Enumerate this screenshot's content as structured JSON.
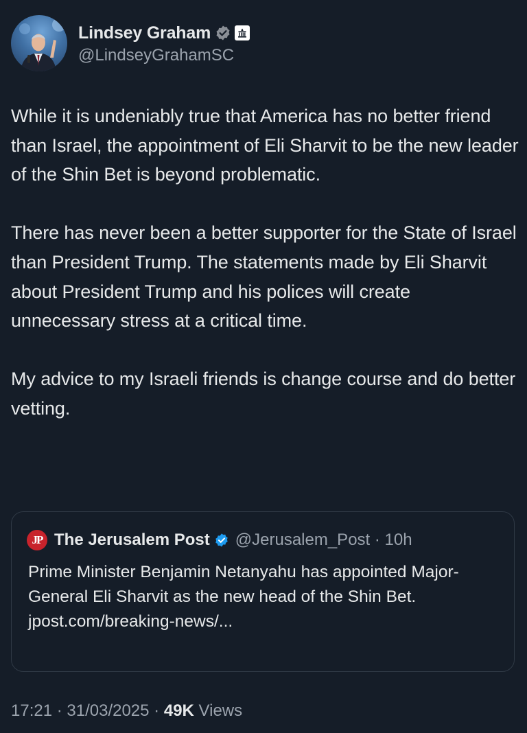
{
  "author": {
    "display_name": "Lindsey Graham",
    "handle": "@LindseyGrahamSC",
    "verified_icon": "verified-badge-icon",
    "affiliation_icon": "government-building-icon",
    "colors": {
      "verified": "#8a8f96"
    }
  },
  "tweet": {
    "paragraphs": [
      "While it is undeniably true that America has no better friend than Israel, the appointment of Eli Sharvit to be the new leader of the Shin Bet is beyond problematic.",
      "There has never been a better supporter for the State of Israel than President Trump. The statements made by Eli Sharvit about President Trump and his polices will create unnecessary stress at a critical time.",
      "My advice to my Israeli friends is change course and do better vetting."
    ]
  },
  "quote": {
    "logo_text": "JP",
    "name": "The Jerusalem Post",
    "handle_time": "@Jerusalem_Post · 10h",
    "text": "Prime Minister Benjamin Netanyahu has appointed Major-General Eli Sharvit as the new head of the Shin Bet.",
    "link": "jpost.com/breaking-news/...",
    "colors": {
      "logo_bg": "#c8232c",
      "verified": "#1d9bf0"
    }
  },
  "meta": {
    "timestamp": "17:21 · 31/03/2025 · ",
    "views_count": "49K",
    "views_label": " Views"
  },
  "colors": {
    "background": "#151d28",
    "text": "#e7e9ea",
    "muted": "#9ba3ad",
    "border": "#303a46"
  }
}
